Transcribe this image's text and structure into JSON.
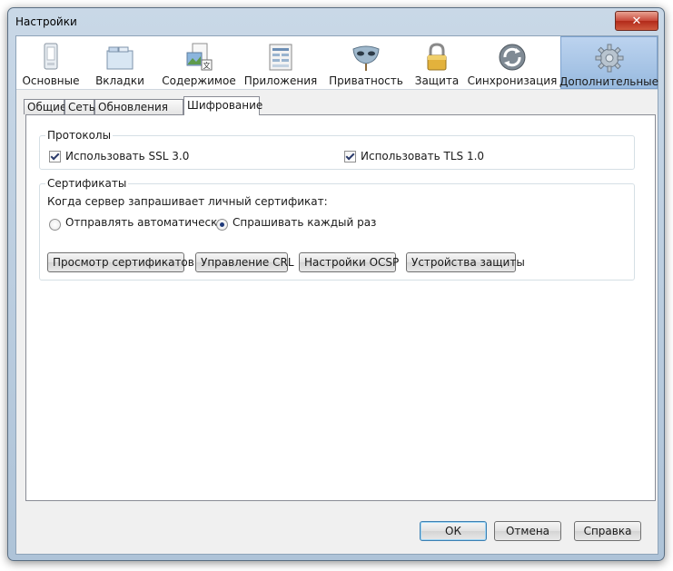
{
  "window": {
    "title": "Настройки",
    "close_glyph": "✕"
  },
  "toolbar": {
    "items": [
      {
        "label": "Основные",
        "icon": "general-icon"
      },
      {
        "label": "Вкладки",
        "icon": "tabs-icon"
      },
      {
        "label": "Содержимое",
        "icon": "content-icon"
      },
      {
        "label": "Приложения",
        "icon": "applications-icon"
      },
      {
        "label": "Приватность",
        "icon": "privacy-mask-icon"
      },
      {
        "label": "Защита",
        "icon": "security-lock-icon"
      },
      {
        "label": "Синхронизация",
        "icon": "sync-icon"
      },
      {
        "label": "Дополнительные",
        "icon": "advanced-gear-icon",
        "selected": true
      }
    ]
  },
  "subtabs": [
    {
      "label": "Общие"
    },
    {
      "label": "Сеть"
    },
    {
      "label": "Обновления"
    },
    {
      "label": "Шифрование",
      "active": true
    }
  ],
  "protocols": {
    "legend": "Протоколы",
    "ssl_label": "Использовать SSL 3.0",
    "ssl_checked": true,
    "tls_label": "Использовать TLS 1.0",
    "tls_checked": true
  },
  "certificates": {
    "legend": "Сертификаты",
    "prompt": "Когда сервер запрашивает личный сертификат:",
    "auto_label": "Отправлять автоматически",
    "ask_label": "Спрашивать каждый раз",
    "selected": "ask",
    "buttons": {
      "view": "Просмотр сертификатов",
      "crl": "Управление CRL",
      "ocsp": "Настройки OCSP",
      "devices": "Устройства защиты"
    }
  },
  "footer": {
    "ok": "ОК",
    "cancel": "Отмена",
    "help": "Справка"
  },
  "colors": {
    "selected_pane": "#a9c6e8",
    "accent": "#3c7fb1"
  }
}
